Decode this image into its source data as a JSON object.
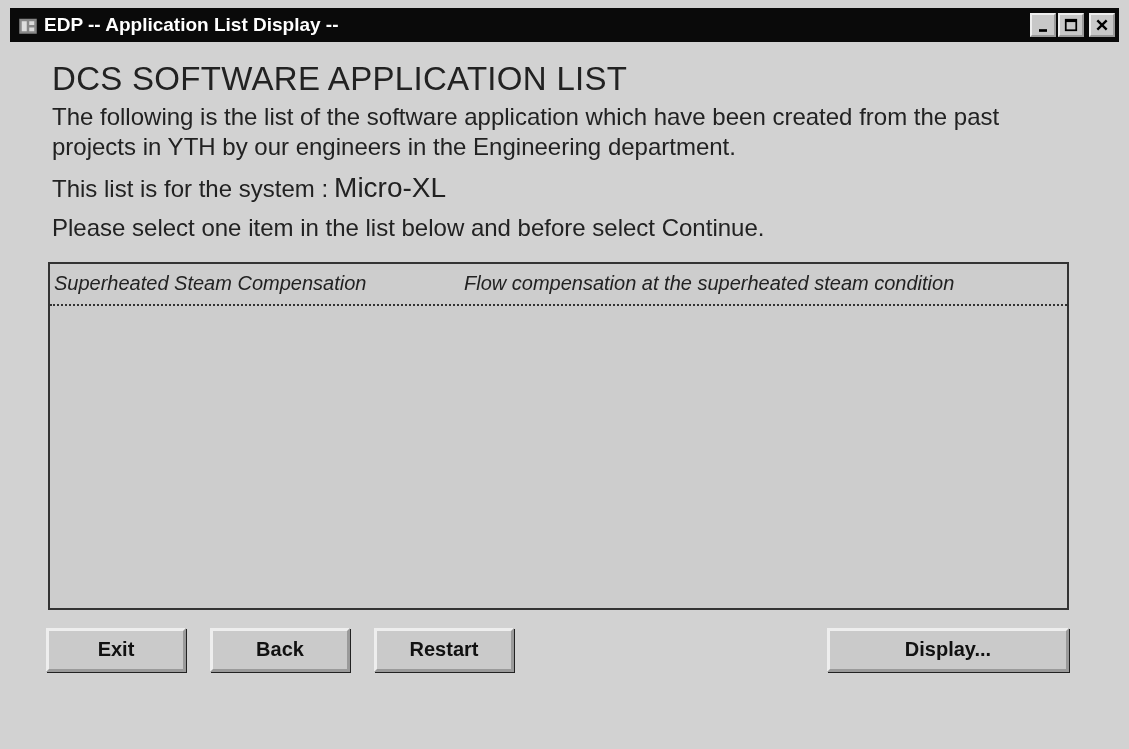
{
  "window": {
    "title": "EDP -- Application List Display --"
  },
  "heading": "DCS SOFTWARE APPLICATION LIST",
  "description": "The following is the list of the software application which have been created from the past projects in YTH by our engineers in the Engineering department.",
  "system_line": {
    "label": "This list is for the system :",
    "value": "Micro-XL"
  },
  "instruction": "Please select one item in the list below and before select Continue.",
  "list": {
    "rows": [
      {
        "name": "Superheated Steam Compensation",
        "description": "Flow compensation at the superheated steam condition",
        "focused": true
      }
    ]
  },
  "buttons": [
    {
      "label": "Exit",
      "kind": "left"
    },
    {
      "label": "Back",
      "kind": "left"
    },
    {
      "label": "Restart",
      "kind": "left"
    },
    {
      "label": "Display...",
      "kind": "right"
    }
  ]
}
